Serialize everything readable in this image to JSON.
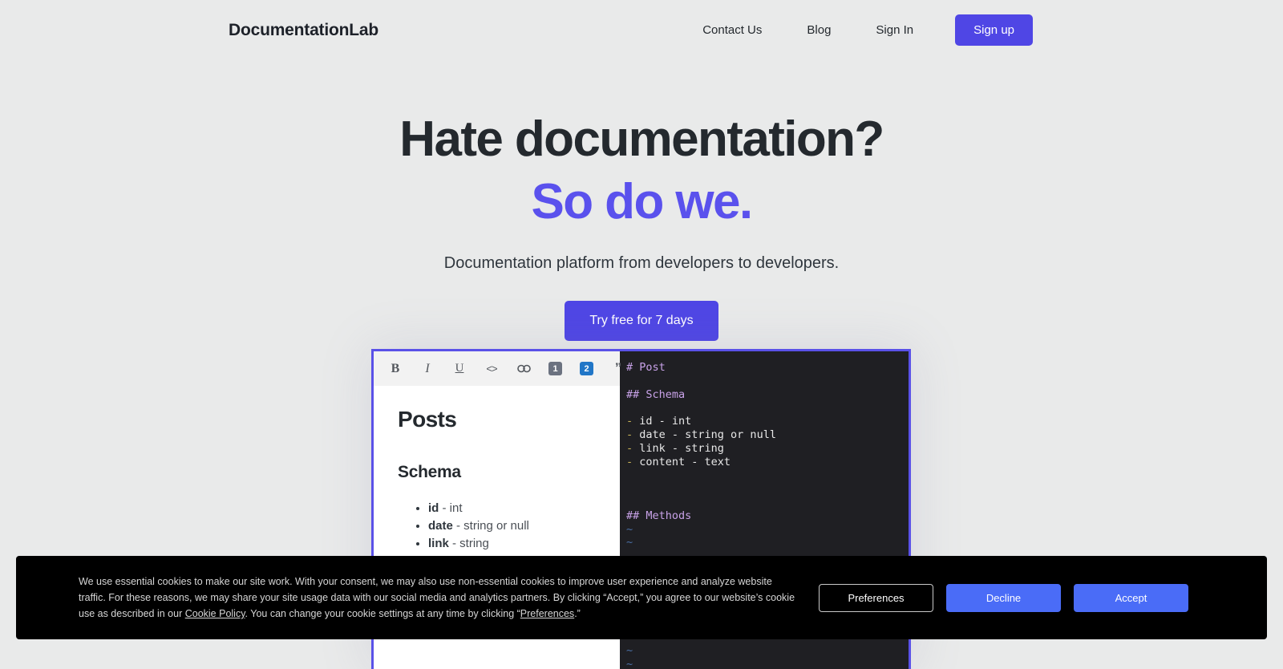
{
  "brand": "DocumentationLab",
  "nav": {
    "links": [
      {
        "label": "Contact Us"
      },
      {
        "label": "Blog"
      },
      {
        "label": "Sign In"
      }
    ],
    "signup_label": "Sign up"
  },
  "hero": {
    "title_line1": "Hate documentation?",
    "title_line2": "So do we.",
    "subtitle": "Documentation platform from developers to developers.",
    "cta_label": "Try free for 7 days",
    "accent_color": "#5a51ed",
    "button_color": "#4f46e5"
  },
  "editor": {
    "border_color": "#5a51e8",
    "toolbar": [
      {
        "name": "bold-icon",
        "glyph": "B"
      },
      {
        "name": "italic-icon",
        "glyph": "I"
      },
      {
        "name": "underline-icon",
        "glyph": "U"
      },
      {
        "name": "code-icon",
        "glyph": "<>"
      },
      {
        "name": "link-icon",
        "glyph": "⚭"
      },
      {
        "name": "heading-1-icon",
        "glyph": "1"
      },
      {
        "name": "heading-2-icon",
        "glyph": "2"
      },
      {
        "name": "blockquote-icon",
        "glyph": "”"
      }
    ],
    "preview": {
      "heading": "Posts",
      "subheading": "Schema",
      "fields": [
        {
          "name": "id",
          "type": " - int"
        },
        {
          "name": "date",
          "type": " - string or null"
        },
        {
          "name": "link",
          "type": " - string"
        }
      ],
      "lower_heading": "Methods"
    },
    "code": {
      "lines": [
        {
          "kind": "head",
          "text": "# Post"
        },
        {
          "kind": "blank",
          "text": ""
        },
        {
          "kind": "head",
          "text": "## Schema"
        },
        {
          "kind": "blank",
          "text": ""
        },
        {
          "kind": "item",
          "dash": "- ",
          "text": "id - int"
        },
        {
          "kind": "item",
          "dash": "- ",
          "text": "date - string or null"
        },
        {
          "kind": "item",
          "dash": "- ",
          "text": "link - string"
        },
        {
          "kind": "item",
          "dash": "- ",
          "text": "content - text"
        },
        {
          "kind": "blank",
          "text": ""
        },
        {
          "kind": "blank",
          "text": ""
        },
        {
          "kind": "blank",
          "text": ""
        },
        {
          "kind": "head",
          "text": "## Methods"
        },
        {
          "kind": "tilde",
          "text": "~"
        },
        {
          "kind": "tilde",
          "text": "~"
        },
        {
          "kind": "blank",
          "text": ""
        },
        {
          "kind": "blank",
          "text": ""
        },
        {
          "kind": "blank",
          "text": ""
        },
        {
          "kind": "blank",
          "text": ""
        },
        {
          "kind": "blank",
          "text": ""
        },
        {
          "kind": "blank",
          "text": ""
        },
        {
          "kind": "blank",
          "text": ""
        },
        {
          "kind": "tilde",
          "text": "~"
        },
        {
          "kind": "tilde",
          "text": "~"
        }
      ]
    }
  },
  "cookie_banner": {
    "text_part1": "We use essential cookies to make our site work. With your consent, we may also use non-essential cookies to improve user experience and analyze website traffic. For these reasons, we may share your site usage data with our social media and analytics partners. By clicking “Accept,” you agree to our website’s cookie use as described in our ",
    "link_label": "Cookie Policy",
    "text_part2": ". You can change your cookie settings at any time by clicking “",
    "link_label2": "Preferences",
    "text_part3": ".”",
    "preferences_label": "Preferences",
    "decline_label": "Decline",
    "accept_label": "Accept",
    "accent_color": "#4a6cf7"
  }
}
